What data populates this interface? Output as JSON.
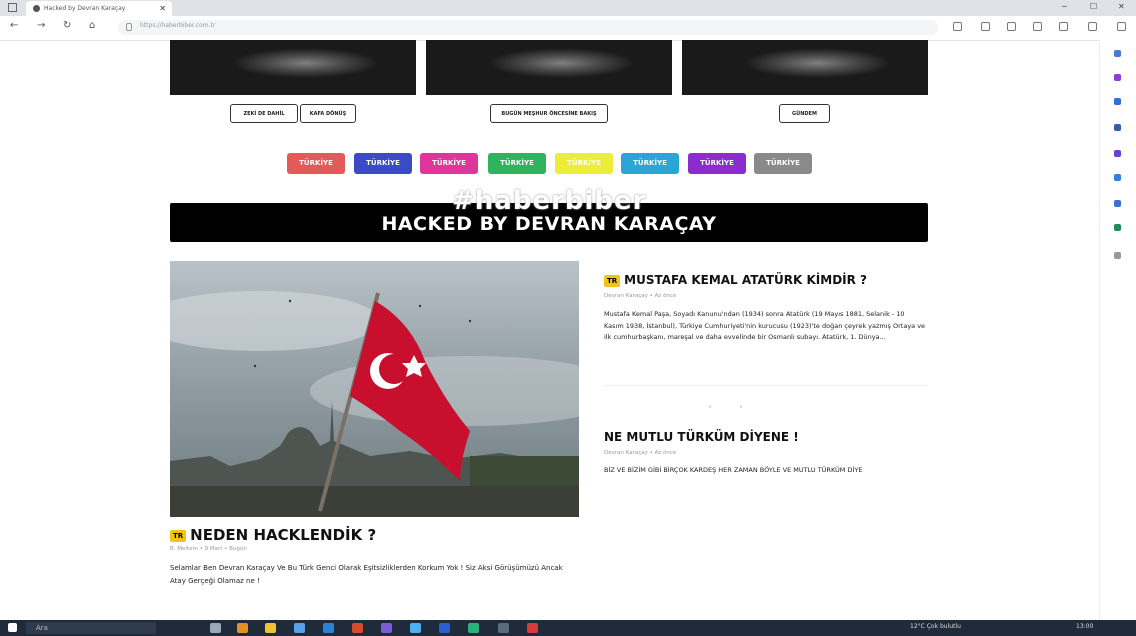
{
  "browser": {
    "tab_title": "Hacked by Devran Karaçay",
    "tab_close": "✕",
    "url": "https://haberbiber.com.tr",
    "nav": {
      "back": "←",
      "forward": "→",
      "reload": "↻",
      "home": "⌂"
    },
    "window_controls": {
      "minimize": "─",
      "maximize": "☐",
      "close": "✕"
    }
  },
  "top_tags": [
    {
      "label": "ZEKİ DE DAHİL"
    },
    {
      "label": "KAFA DÖNÜŞ"
    },
    {
      "label": "BUGÜN MEŞHUR ÖNCESİNE BAKIŞ"
    },
    {
      "label": "GÜNDEM"
    }
  ],
  "categories": [
    {
      "label": "TÜRKİYE",
      "color": "#e25a5a"
    },
    {
      "label": "TÜRKİYE",
      "color": "#3b4bc8"
    },
    {
      "label": "TÜRKİYE",
      "color": "#e0359a"
    },
    {
      "label": "TÜRKİYE",
      "color": "#2fb35f"
    },
    {
      "label": "TÜRKİYE",
      "color": "#ecec3a"
    },
    {
      "label": "TÜRKİYE",
      "color": "#2aa6d6"
    },
    {
      "label": "TÜRKİYE",
      "color": "#8b2ccf"
    },
    {
      "label": "TÜRKİYE",
      "color": "#8a8a8a"
    }
  ],
  "watermark": "#haberbiber",
  "banner": "HACKED BY DEVRAN KARAÇAY",
  "badge": "TR",
  "main_article": {
    "title": "NEDEN HACKLENDİK ?",
    "meta": "B. Meltem • 9 Mart • Bugün",
    "excerpt": "Selamlar Ben Devran Karaçay Ve Bu Türk Genci Olarak Eşitsizliklerden Korkum Yok ! Siz Aksi Görüşümüzü Ancak Atay Gerçeği Olamaz ne !"
  },
  "side_articles": [
    {
      "title": "MUSTAFA KEMAL ATATÜRK KİMDİR ?",
      "meta": "Devran Karaçay • Az önce",
      "excerpt": "Mustafa Kemal Paşa, Soyadı Kanunu'ndan (1934) sonra Atatürk (19 Mayıs 1881, Selanik - 10 Kasım 1938, İstanbul), Türkiye Cumhuriyeti'nin kurucusu (1923)'te doğan çeyrek yazmış Ortaya ve ilk cumhurbaşkanı, mareşal ve daha evvelinde bir Osmanlı subayı. Atatürk, 1. Dünya..."
    },
    {
      "title": "NE MUTLU TÜRKÜM DİYENE !",
      "meta": "Devran Karaçay • Az önce",
      "excerpt": "BİZ VE BİZİM GİBİ BİRÇOK KARDEŞ HER ZAMAN BÖYLE VE MUTLU TÜRKÜM DİYE"
    }
  ],
  "taskbar": {
    "search": "Ara",
    "tray_text": "12°C Çok bulutlu",
    "clock": "13:00"
  }
}
